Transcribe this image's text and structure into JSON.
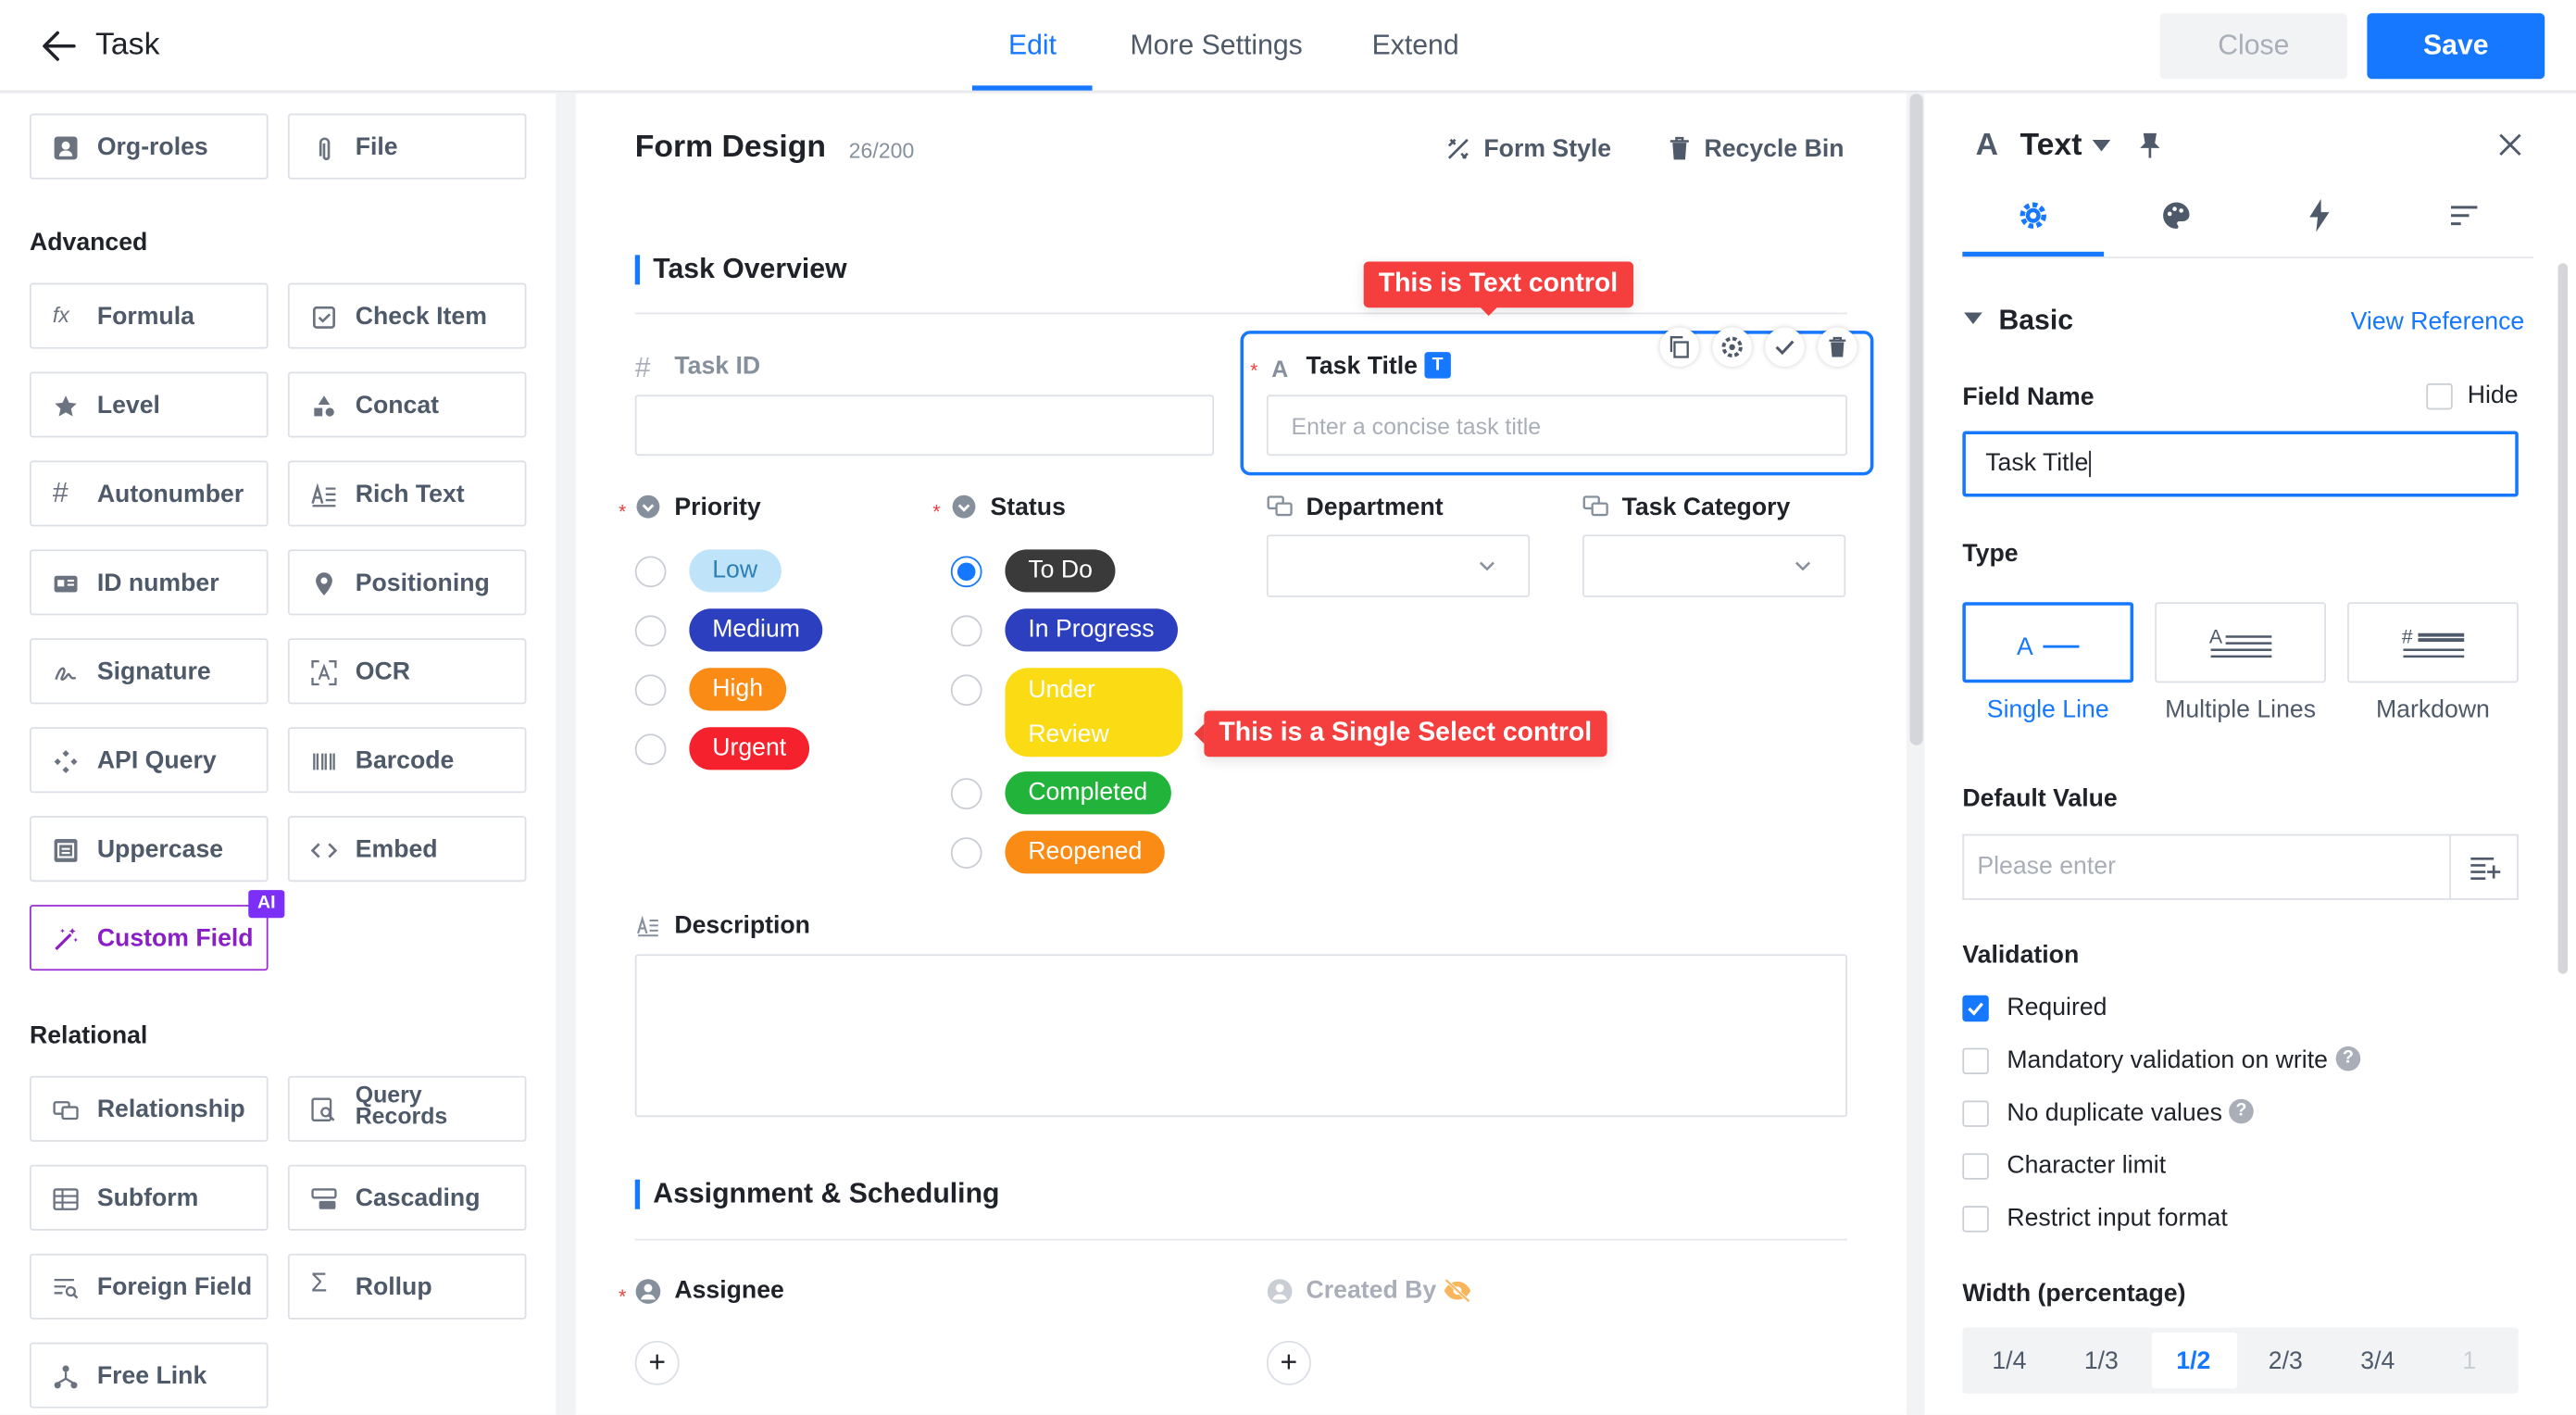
{
  "header": {
    "title": "Task",
    "tabs": [
      {
        "label": "Edit",
        "active": true
      },
      {
        "label": "More Settings",
        "active": false
      },
      {
        "label": "Extend",
        "active": false
      }
    ],
    "close_label": "Close",
    "save_label": "Save"
  },
  "left_panel": {
    "top_row": [
      "Org-roles",
      "File"
    ],
    "advanced_title": "Advanced",
    "advanced_items": [
      "Formula",
      "Check Item",
      "Level",
      "Concat",
      "Autonumber",
      "Rich Text",
      "ID number",
      "Positioning",
      "Signature",
      "OCR",
      "API Query",
      "Barcode",
      "Uppercase",
      "Embed",
      "Custom Field"
    ],
    "ai_badge": "AI",
    "relational_title": "Relational",
    "relational_items": [
      "Relationship",
      "Query\nRecords",
      "Subform",
      "Cascading",
      "Foreign Field",
      "Rollup",
      "Free Link"
    ]
  },
  "form": {
    "title": "Form Design",
    "count": "26/200",
    "form_style_label": "Form Style",
    "recycle_bin_label": "Recycle Bin",
    "section1": "Task Overview",
    "task_id_label": "Task ID",
    "task_title_label": "Task Title",
    "task_title_badge": "T",
    "task_title_placeholder": "Enter a concise task title",
    "tooltip_text": "This is Text control",
    "tooltip_select": "This is a Single Select control",
    "priority_label": "Priority",
    "priority_options": [
      "Low",
      "Medium",
      "High",
      "Urgent"
    ],
    "status_label": "Status",
    "status_options": [
      "To Do",
      "In Progress",
      "Under\nReview",
      "Completed",
      "Reopened"
    ],
    "department_label": "Department",
    "category_label": "Task Category",
    "description_label": "Description",
    "section2": "Assignment & Scheduling",
    "assignee_label": "Assignee",
    "created_by_label": "Created By",
    "colors": {
      "low_bg": "#bfe3f8",
      "low_fg": "#2d7fb5",
      "medium_bg": "#2b3fbf",
      "high_bg": "#fa8c16",
      "urgent_bg": "#f5222d",
      "todo_bg": "#3a3a3a",
      "inprogress_bg": "#2b3fbf",
      "review_bg": "#fadb14",
      "completed_bg": "#22b33a",
      "reopened_bg": "#fa8c16",
      "accent": "#1677ff"
    }
  },
  "props": {
    "control_type": "Text",
    "section": "Basic",
    "view_reference": "View Reference",
    "field_name_label": "Field Name",
    "hide_label": "Hide",
    "field_name_value": "Task Title",
    "type_label": "Type",
    "types": [
      "Single Line",
      "Multiple Lines",
      "Markdown"
    ],
    "default_value_label": "Default Value",
    "default_value_placeholder": "Please enter",
    "validation_label": "Validation",
    "validations": [
      {
        "label": "Required",
        "checked": true
      },
      {
        "label": "Mandatory validation on write",
        "checked": false,
        "help": true
      },
      {
        "label": "No duplicate values",
        "checked": false,
        "help": true
      },
      {
        "label": "Character limit",
        "checked": false
      },
      {
        "label": "Restrict input format",
        "checked": false
      }
    ],
    "width_label": "Width (percentage)",
    "widths": [
      "1/4",
      "1/3",
      "1/2",
      "2/3",
      "3/4",
      "1"
    ],
    "selected_width": "1/2"
  }
}
